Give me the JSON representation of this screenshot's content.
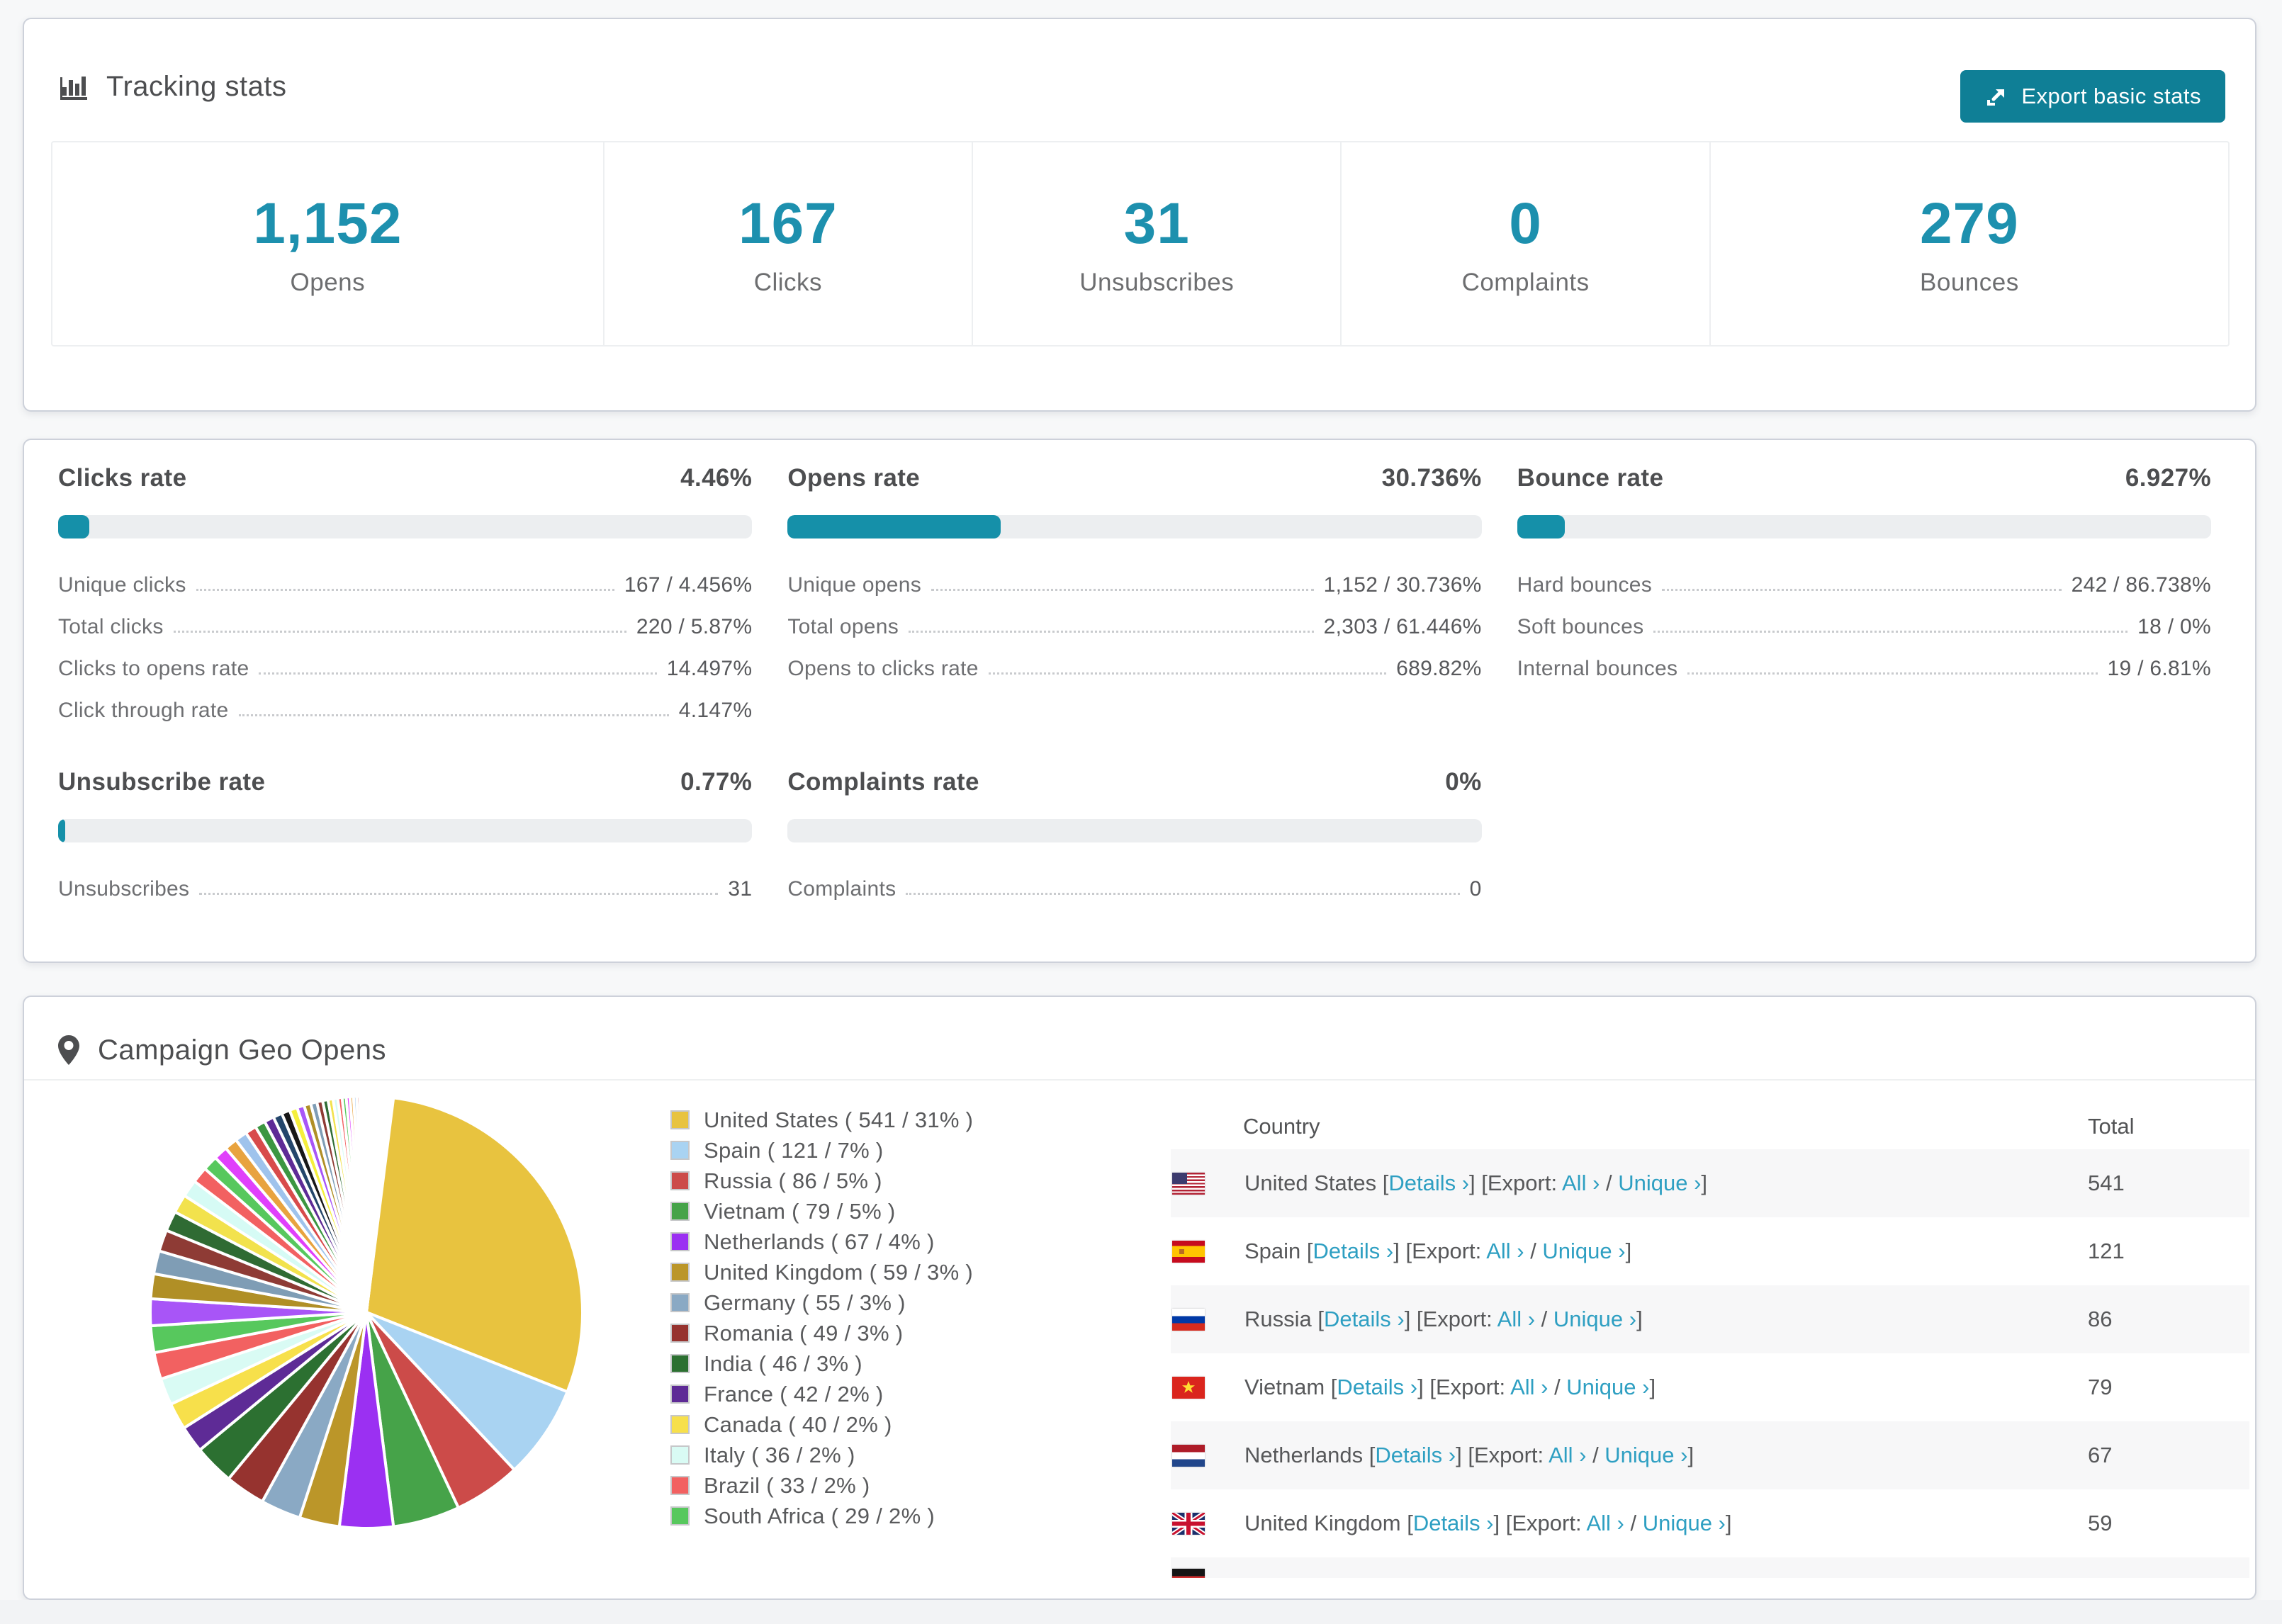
{
  "colors": {
    "accent_number": "#1d90ae",
    "button_bg": "#0f7f96",
    "bar_fill": "#1590a9",
    "link": "#2e9fc2",
    "card_border": "#cdd1da",
    "stripe": "#f7f7f8"
  },
  "tracking_stats": {
    "title": "Tracking stats",
    "export_button": "Export basic stats",
    "summary": [
      {
        "value": "1,152",
        "label": "Opens"
      },
      {
        "value": "167",
        "label": "Clicks"
      },
      {
        "value": "31",
        "label": "Unsubscribes"
      },
      {
        "value": "0",
        "label": "Complaints"
      },
      {
        "value": "279",
        "label": "Bounces"
      }
    ]
  },
  "rates": {
    "blocks": [
      {
        "title": "Clicks rate",
        "value": "4.46%",
        "percent": 4.46,
        "grid_area": "1 / 1",
        "rows": [
          {
            "label": "Unique clicks",
            "value": "167 / 4.456%"
          },
          {
            "label": "Total clicks",
            "value": "220 / 5.87%"
          },
          {
            "label": "Clicks to opens rate",
            "value": "14.497%"
          },
          {
            "label": "Click through rate",
            "value": "4.147%"
          }
        ]
      },
      {
        "title": "Opens rate",
        "value": "30.736%",
        "percent": 30.736,
        "grid_area": "1 / 2",
        "rows": [
          {
            "label": "Unique opens",
            "value": "1,152 / 30.736%"
          },
          {
            "label": "Total opens",
            "value": "2,303 / 61.446%"
          },
          {
            "label": "Opens to clicks rate",
            "value": "689.82%"
          }
        ]
      },
      {
        "title": "Bounce rate",
        "value": "6.927%",
        "percent": 6.927,
        "grid_area": "1 / 3",
        "rows": [
          {
            "label": "Hard bounces",
            "value": "242 / 86.738%"
          },
          {
            "label": "Soft bounces",
            "value": "18 / 0%"
          },
          {
            "label": "Internal bounces",
            "value": "19 / 6.81%"
          }
        ]
      },
      {
        "title": "Unsubscribe rate",
        "value": "0.77%",
        "percent": 0.77,
        "grid_area": "2 / 1",
        "rows": [
          {
            "label": "Unsubscribes",
            "value": "31"
          }
        ]
      },
      {
        "title": "Complaints rate",
        "value": "0%",
        "percent": 0,
        "grid_area": "2 / 2",
        "rows": [
          {
            "label": "Complaints",
            "value": "0"
          }
        ]
      }
    ]
  },
  "geo": {
    "title": "Campaign Geo Opens",
    "legend": [
      {
        "label": "United States ( 541 / 31% )",
        "color": "#e8c33f"
      },
      {
        "label": "Spain ( 121 / 7% )",
        "color": "#a9d3f2"
      },
      {
        "label": "Russia ( 86 / 5% )",
        "color": "#cc4b49"
      },
      {
        "label": "Vietnam ( 79 / 5% )",
        "color": "#46a349"
      },
      {
        "label": "Netherlands ( 67 / 4% )",
        "color": "#9b30f2"
      },
      {
        "label": "United Kingdom ( 59 / 3% )",
        "color": "#bb9629"
      },
      {
        "label": "Germany ( 55 / 3% )",
        "color": "#8aa9c4"
      },
      {
        "label": "Romania ( 49 / 3% )",
        "color": "#96332f"
      },
      {
        "label": "India ( 46 / 3% )",
        "color": "#2c7031"
      },
      {
        "label": "France ( 42 / 2% )",
        "color": "#5e2b96"
      },
      {
        "label": "Canada ( 40 / 2% )",
        "color": "#f7e04b"
      },
      {
        "label": "Italy ( 36 / 2% )",
        "color": "#d9fbf4"
      },
      {
        "label": "Brazil ( 33 / 2% )",
        "color": "#f26161"
      },
      {
        "label": "South Africa ( 29 / 2% )",
        "color": "#57c85d"
      }
    ],
    "chart_data": {
      "type": "pie",
      "title": "Campaign Geo Opens",
      "labels": [
        "United States",
        "Spain",
        "Russia",
        "Vietnam",
        "Netherlands",
        "United Kingdom",
        "Germany",
        "Romania",
        "India",
        "France",
        "Canada",
        "Italy",
        "Brazil",
        "South Africa"
      ],
      "counts": [
        541,
        121,
        86,
        79,
        67,
        59,
        55,
        49,
        46,
        42,
        40,
        36,
        33,
        29
      ],
      "percents": [
        31,
        7,
        5,
        5,
        4,
        3,
        3,
        3,
        3,
        2,
        2,
        2,
        2,
        2
      ],
      "other_tail_percent": 28,
      "tail_slices_estimated": true,
      "start_angle": "top",
      "direction": "clockwise",
      "legend_position": "right"
    },
    "table": {
      "headers": {
        "country": "Country",
        "total": "Total"
      },
      "link_labels": {
        "bracket_open": "[",
        "bracket_close": "]",
        "details": "Details",
        "chevron": "›",
        "export": "Export:",
        "all": "All",
        "slash": "/",
        "unique": "Unique"
      },
      "rows": [
        {
          "country": "United States",
          "total": "541",
          "flag": "us",
          "striped": true,
          "partial": false
        },
        {
          "country": "Spain",
          "total": "121",
          "flag": "es",
          "striped": false,
          "partial": false
        },
        {
          "country": "Russia",
          "total": "86",
          "flag": "ru",
          "striped": true,
          "partial": false
        },
        {
          "country": "Vietnam",
          "total": "79",
          "flag": "vn",
          "striped": false,
          "partial": false
        },
        {
          "country": "Netherlands",
          "total": "67",
          "flag": "nl",
          "striped": true,
          "partial": false
        },
        {
          "country": "United Kingdom",
          "total": "59",
          "flag": "uk",
          "striped": false,
          "partial": false
        },
        {
          "country": "",
          "total": "",
          "flag": "de",
          "striped": true,
          "partial": true
        }
      ]
    }
  }
}
